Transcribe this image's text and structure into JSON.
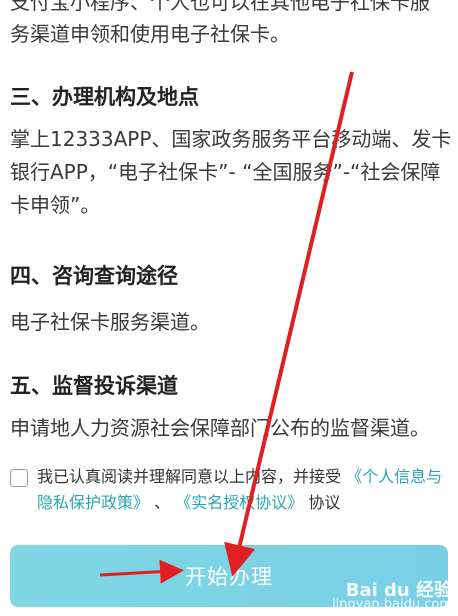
{
  "sections": {
    "partial_line1": "支付宝小程序、个人也可以在其他电子社保卡服",
    "partial_line2": "务渠道申领和使用电子社保卡。",
    "section3": {
      "heading": "三、办理机构及地点",
      "body": "掌上12333APP、国家政务服务平台移动端、发卡银行APP，“电子社保卡”- “全国服务”-“社会保障卡申领”。"
    },
    "section4": {
      "heading": "四、咨询查询途径",
      "body": "电子社保卡服务渠道。"
    },
    "section5": {
      "heading": "五、监督投诉渠道",
      "body": "申请地人力资源社会保障部门公布的监督渠道。"
    }
  },
  "agreement": {
    "text_prefix": "我已认真阅读并理解同意以上内容，并接受",
    "link1": "《个人信息与隐私保护政策》",
    "separator": "、",
    "link2": "《实名授权协议》",
    "suffix": "协议",
    "checked": false
  },
  "start_button": {
    "label": "开始办理"
  },
  "watermark": {
    "brand": "Bai du 经验",
    "url": "jingyan.baidu.com"
  },
  "colors": {
    "accent": "#2aa6b3",
    "button": "#7fd7e2",
    "annotation_arrow": "#e02020"
  }
}
